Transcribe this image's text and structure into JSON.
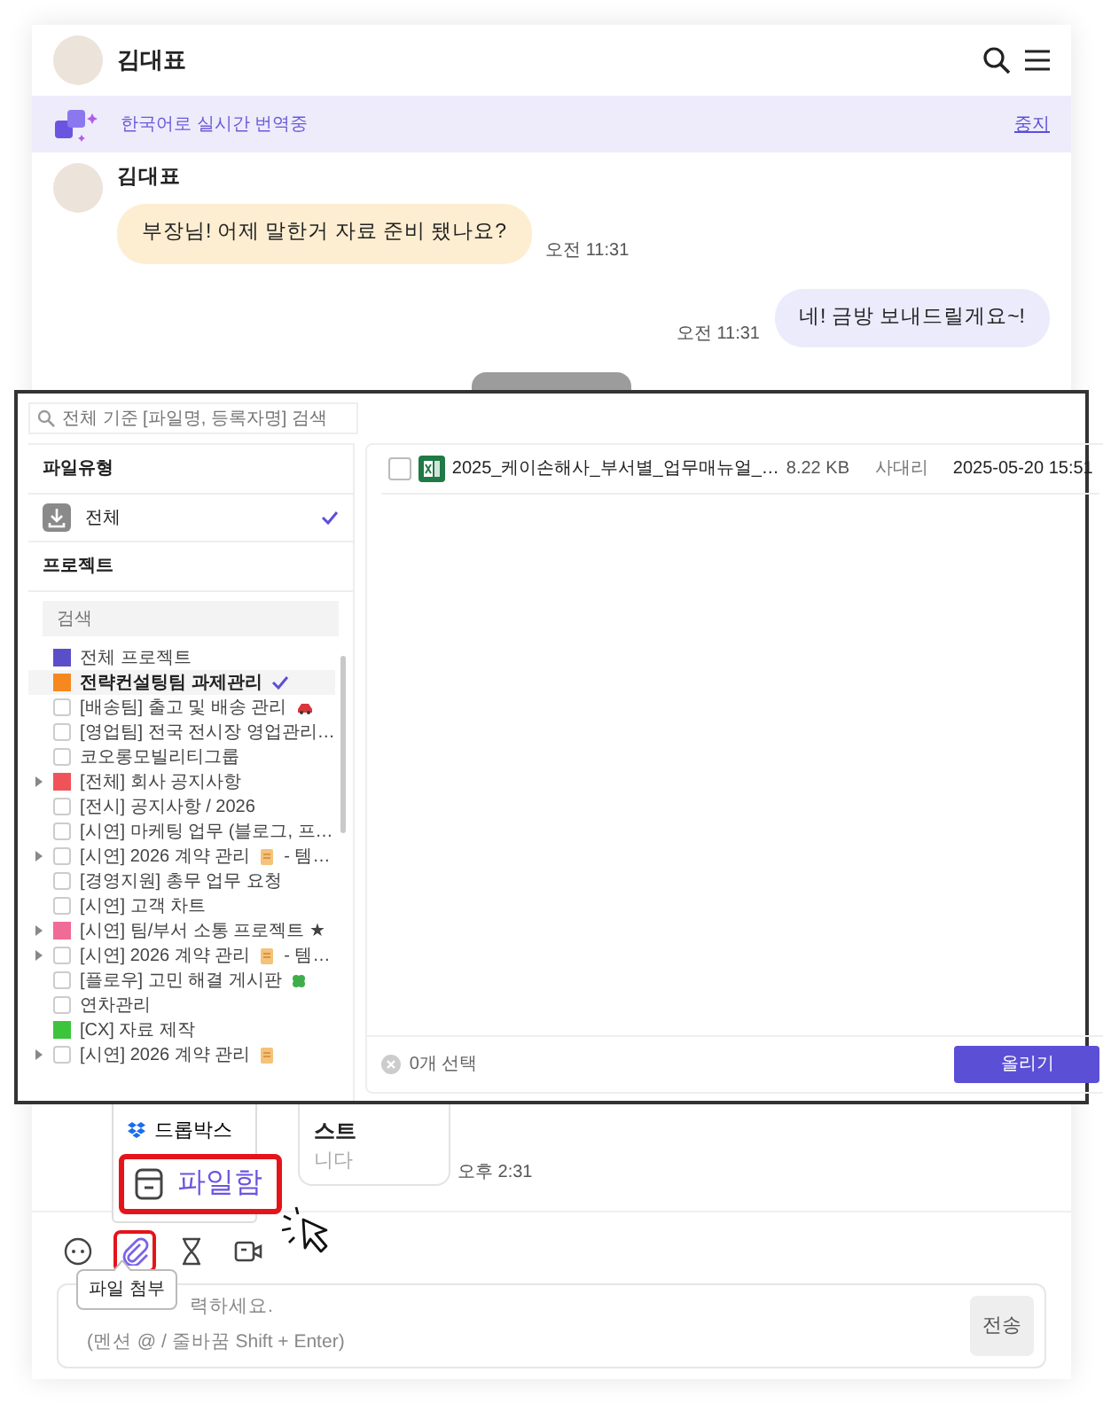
{
  "header": {
    "name": "김대표"
  },
  "translation_bar": {
    "text": "한국어로 실시간 번역중",
    "action": "중지"
  },
  "messages": [
    {
      "kind": "received",
      "sender": "김대표",
      "text": "부장님! 어제 말한거 자료 준비 됐나요?",
      "time": "오전 11:31"
    },
    {
      "kind": "sent",
      "text": "네! 금방 보내드릴게요~!",
      "time": "오전 11:31"
    }
  ],
  "partial_card": {
    "title": "스트",
    "body": "니다",
    "time": "오후 2:31"
  },
  "file_modal": {
    "search_placeholder": "전체 기준 [파일명, 등록자명] 검색",
    "file_type_heading": "파일유형",
    "file_types": [
      {
        "label": "전체",
        "selected": true
      }
    ],
    "project_heading": "프로젝트",
    "project_search_placeholder": "검색",
    "projects": [
      {
        "kind": "color",
        "color": "#5b4fc9",
        "label": "전체 프로젝트",
        "expandable": false,
        "selected": false
      },
      {
        "kind": "color",
        "color": "#f5891f",
        "label": "전략컨설팅팀 과제관리",
        "expandable": false,
        "selected": true
      },
      {
        "kind": "checkbox",
        "checked": false,
        "label": "[배송팀] 출고 및 배송 관리",
        "expandable": false,
        "selected": false
      },
      {
        "kind": "checkbox",
        "checked": false,
        "label": "[영업팀] 전국 전시장 영업관리…",
        "expandable": false,
        "selected": false
      },
      {
        "kind": "checkbox",
        "checked": false,
        "label": "코오롱모빌리티그룹",
        "expandable": false,
        "selected": false
      },
      {
        "kind": "color",
        "color": "#ef5359",
        "label": "[전체] 회사 공지사항",
        "expandable": true,
        "selected": false
      },
      {
        "kind": "checkbox",
        "checked": false,
        "label": "[전시] 공지사항 / 2026",
        "expandable": false,
        "selected": false
      },
      {
        "kind": "checkbox",
        "checked": false,
        "label": "[시연] 마케팅 업무 (블로그, 프…",
        "expandable": false,
        "selected": false
      },
      {
        "kind": "checkbox",
        "checked": false,
        "label": "[시연] 2026 계약 관리",
        "suffix": "- 템…",
        "expandable": true,
        "selected": false
      },
      {
        "kind": "checkbox",
        "checked": false,
        "label": "[경영지원] 총무 업무 요청",
        "expandable": false,
        "selected": false
      },
      {
        "kind": "checkbox",
        "checked": false,
        "label": "[시연] 고객 차트",
        "expandable": false,
        "selected": false
      },
      {
        "kind": "color",
        "color": "#f06b95",
        "label": "[시연] 팀/부서 소통 프로젝트 ★",
        "expandable": true,
        "selected": false
      },
      {
        "kind": "checkbox",
        "checked": false,
        "label": "[시연] 2026 계약 관리",
        "suffix": "- 템…",
        "expandable": true,
        "selected": false
      },
      {
        "kind": "checkbox",
        "checked": false,
        "label": "[플로우] 고민 해결 게시판",
        "expandable": false,
        "selected": false
      },
      {
        "kind": "checkbox",
        "checked": false,
        "label": "연차관리",
        "expandable": false,
        "selected": false
      },
      {
        "kind": "color",
        "color": "#3cc43c",
        "label": "[CX] 자료 제작",
        "expandable": false,
        "selected": false
      },
      {
        "kind": "checkbox",
        "checked": false,
        "label": "[시연] 2026 계약 관리",
        "expandable": true,
        "selected": false
      }
    ],
    "files": [
      {
        "checked": false,
        "name": "2025_케이손해사_부서별_업무매뉴얼_…",
        "size": "8.22 KB",
        "uploader": "사대리",
        "date": "2025-05-20 15:51"
      }
    ],
    "selection_count": "0개 선택",
    "upload_button": "올리기"
  },
  "attach_menu": {
    "items": [
      {
        "label": "드롭박스",
        "highlighted": false
      },
      {
        "label": "파일함",
        "highlighted": true
      }
    ]
  },
  "toolbar": {
    "tools": [
      {
        "highlighted": false
      },
      {
        "highlighted": true
      },
      {
        "highlighted": false
      },
      {
        "highlighted": false
      }
    ]
  },
  "tooltip": "파일 첨부",
  "composer": {
    "placeholder_lines": [
      "력하세요.",
      "(멘션 @ / 줄바꿈 Shift + Enter)"
    ],
    "send_button": "전송"
  }
}
